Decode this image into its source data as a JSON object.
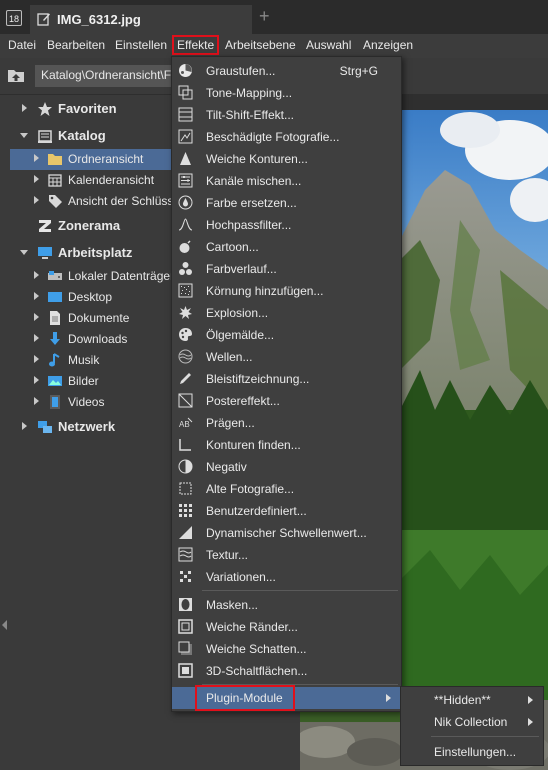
{
  "app": {
    "icon_text": "18"
  },
  "tab": {
    "title": "IMG_6312.jpg",
    "add": "+"
  },
  "menubar": {
    "items": [
      "Datei",
      "Bearbeiten",
      "Einstellen",
      "Effekte",
      "Arbeitsebene",
      "Auswahl",
      "Anzeigen"
    ],
    "highlight_color": "#e0101b"
  },
  "toolbar": {
    "path": "Katalog\\Ordneransicht\\F"
  },
  "tree": {
    "favoriten": "Favoriten",
    "katalog": "Katalog",
    "ordneransicht": "Ordneransicht",
    "kalenderansicht": "Kalenderansicht",
    "schluessel": "Ansicht der Schlüss",
    "zonerama": "Zonerama",
    "arbeitsplatz": "Arbeitsplatz",
    "lokaler": "Lokaler Datenträger",
    "desktop": "Desktop",
    "dokumente": "Dokumente",
    "downloads": "Downloads",
    "musik": "Musik",
    "bilder": "Bilder",
    "videos": "Videos",
    "netzwerk": "Netzwerk"
  },
  "menu": {
    "items": [
      {
        "label": "Graustufen...",
        "shortcut": "Strg+G",
        "icon": "color-wheel-icon"
      },
      {
        "label": "Tone-Mapping...",
        "icon": "layers-icon"
      },
      {
        "label": "Tilt-Shift-Effekt...",
        "icon": "tilt-shift-icon"
      },
      {
        "label": "Beschädigte Fotografie...",
        "icon": "damaged-photo-icon"
      },
      {
        "label": "Weiche Konturen...",
        "icon": "cone-icon"
      },
      {
        "label": "Kanäle mischen...",
        "icon": "sliders-icon"
      },
      {
        "label": "Farbe ersetzen...",
        "icon": "drop-icon"
      },
      {
        "label": "Hochpassfilter...",
        "icon": "curve-icon"
      },
      {
        "label": "Cartoon...",
        "icon": "bomb-icon"
      },
      {
        "label": "Farbverlauf...",
        "icon": "dots-icon"
      },
      {
        "label": "Körnung hinzufügen...",
        "icon": "grain-icon"
      },
      {
        "label": "Explosion...",
        "icon": "burst-icon"
      },
      {
        "label": "Ölgemälde...",
        "icon": "palette-icon"
      },
      {
        "label": "Wellen...",
        "icon": "waves-icon"
      },
      {
        "label": "Bleistiftzeichnung...",
        "icon": "pencil-icon"
      },
      {
        "label": "Postereffekt...",
        "icon": "poster-icon"
      },
      {
        "label": "Prägen...",
        "icon": "emboss-icon"
      },
      {
        "label": "Konturen finden...",
        "icon": "contour-icon"
      },
      {
        "label": "Negativ",
        "icon": "negative-icon"
      },
      {
        "label": "Alte Fotografie...",
        "icon": "old-photo-icon"
      },
      {
        "label": "Benutzerdefiniert...",
        "icon": "grid-icon"
      },
      {
        "label": "Dynamischer Schwellenwert...",
        "icon": "threshold-icon"
      },
      {
        "label": "Textur...",
        "icon": "texture-icon"
      },
      {
        "label": "Variationen...",
        "icon": "variations-icon"
      },
      {
        "label": "Masken...",
        "icon": "mask-icon"
      },
      {
        "label": "Weiche Ränder...",
        "icon": "soft-edges-icon"
      },
      {
        "label": "Weiche Schatten...",
        "icon": "soft-shadow-icon"
      },
      {
        "label": "3D-Schaltflächen...",
        "icon": "3d-button-icon"
      }
    ],
    "plugin": "Plugin-Module"
  },
  "submenu": {
    "items": [
      "**Hidden**",
      "Nik Collection",
      "Einstellungen..."
    ]
  }
}
